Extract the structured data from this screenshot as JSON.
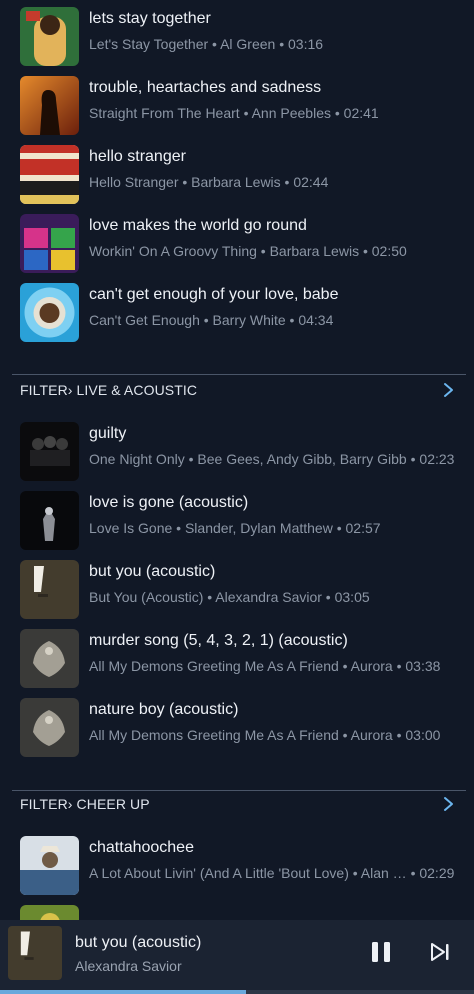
{
  "songs_top": [
    {
      "title": "lets stay together",
      "meta": "Let's Stay Together • Al Green • 03:16"
    },
    {
      "title": "trouble, heartaches and sadness",
      "meta": "Straight From The Heart • Ann Peebles • 02:41"
    },
    {
      "title": "hello stranger",
      "meta": "Hello Stranger • Barbara Lewis • 02:44"
    },
    {
      "title": "love makes the world go round",
      "meta": "Workin' On A Groovy Thing • Barbara Lewis • 02:50"
    },
    {
      "title": "can't get enough of your love, babe",
      "meta": "Can't Get Enough • Barry White • 04:34"
    }
  ],
  "section_live": {
    "label": "FILTER› LIVE & ACOUSTIC"
  },
  "songs_live": [
    {
      "title": "guilty",
      "meta": "One Night Only • Bee Gees, Andy Gibb, Barry Gibb • 02:23"
    },
    {
      "title": "love is gone (acoustic)",
      "meta": "Love Is Gone • Slander, Dylan Matthew • 02:57"
    },
    {
      "title": "but you (acoustic)",
      "meta": "But You (Acoustic) • Alexandra Savior • 03:05"
    },
    {
      "title": "murder song (5, 4, 3, 2, 1) (acoustic)",
      "meta": "All My Demons Greeting Me As A Friend • Aurora • 03:38"
    },
    {
      "title": "nature boy (acoustic)",
      "meta": "All My Demons Greeting Me As A Friend • Aurora • 03:00"
    }
  ],
  "section_cheer": {
    "label": "FILTER› CHEER UP"
  },
  "songs_cheer": [
    {
      "title": "chattahoochee",
      "meta": "A Lot About Livin' (And A Little 'Bout Love) • Alan … • 02:29"
    }
  ],
  "player": {
    "title": "but you (acoustic)",
    "artist": "Alexandra Savior",
    "progress_fraction": 0.52
  },
  "colors": {
    "background": "#111826",
    "accent": "#68a8dc",
    "player_bg": "#1b2332"
  }
}
